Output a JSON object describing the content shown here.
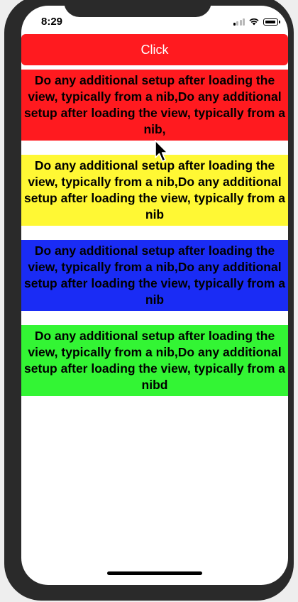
{
  "status_bar": {
    "time": "8:29"
  },
  "button": {
    "label": "Click",
    "color": "#ff1a1f"
  },
  "blocks": [
    {
      "text": "Do any additional setup after loading the view, typically from a nib,Do any additional setup after loading the view, typically from a nib,",
      "color": "#ff1a1f"
    },
    {
      "text": "Do any additional setup after loading the view, typically from a nib,Do any additional setup after loading the view, typically from a nib",
      "color": "#fff834"
    },
    {
      "text": "Do any additional setup after loading the view, typically from a nib,Do any additional setup after loading the view, typically from a nib",
      "color": "#1a2cf5"
    },
    {
      "text": "Do any additional setup after loading the view, typically from a nib,Do any additional setup after loading the view, typically from a nibd",
      "color": "#33f534"
    }
  ],
  "icons": [
    "cellular-signal-icon",
    "wifi-icon",
    "battery-icon",
    "mouse-pointer-icon"
  ]
}
